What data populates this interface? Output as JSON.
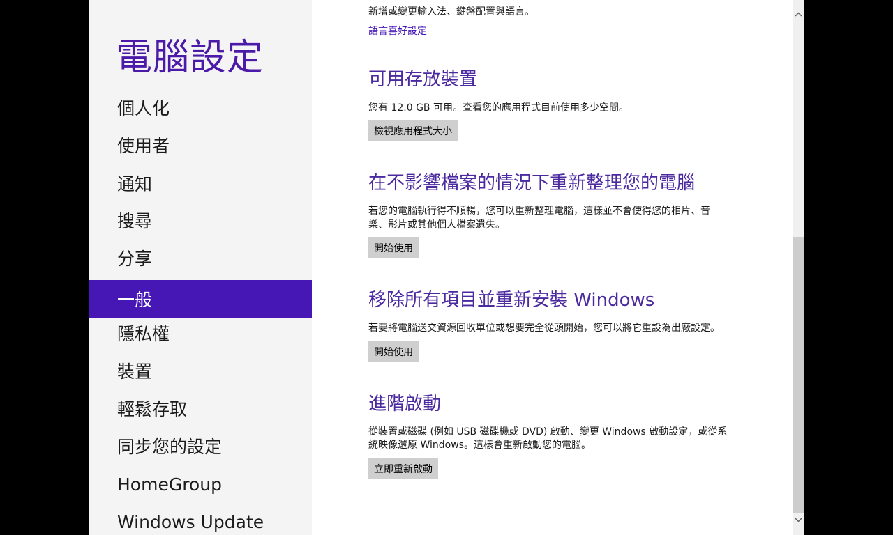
{
  "sidebar": {
    "title": "電腦設定",
    "items": [
      {
        "label": "個人化"
      },
      {
        "label": "使用者"
      },
      {
        "label": "通知"
      },
      {
        "label": "搜尋"
      },
      {
        "label": "分享"
      },
      {
        "label": "一般",
        "active": true
      },
      {
        "label": "隱私權"
      },
      {
        "label": "裝置"
      },
      {
        "label": "輕鬆存取"
      },
      {
        "label": "同步您的設定"
      },
      {
        "label": "HomeGroup"
      },
      {
        "label": "Windows Update"
      }
    ]
  },
  "language": {
    "description": "新增或變更輸入法、鍵盤配置與語言。",
    "link": "語言喜好設定"
  },
  "storage": {
    "heading": "可用存放裝置",
    "description": "您有 12.0 GB 可用。查看您的應用程式目前使用多少空間。",
    "button": "檢視應用程式大小"
  },
  "refresh": {
    "heading": "在不影響檔案的情況下重新整理您的電腦",
    "description_line1": "若您的電腦執行得不順暢，您可以重新整理電腦，這樣並不會使得您的相片、音",
    "description_line2": "樂、影片或其他個人檔案遺失。",
    "button": "開始使用"
  },
  "reset": {
    "heading": "移除所有項目並重新安裝 Windows",
    "description": "若要將電腦送交資源回收單位或想要完全從頭開始，您可以將它重設為出廠設定。",
    "button": "開始使用"
  },
  "advanced": {
    "heading": "進階啟動",
    "description_line1": "從裝置或磁碟 (例如 USB 磁碟機或 DVD) 啟動、變更 Windows 啟動設定，或從系",
    "description_line2": "統映像還原 Windows。這樣會重新啟動您的電腦。",
    "button": "立即重新啟動"
  },
  "icons": {
    "scroll_up": "chevron-up-icon",
    "scroll_down": "chevron-down-icon"
  },
  "colors": {
    "accent": "#4617b4",
    "heading": "#4b2aa0",
    "sidebar_bg": "#f4f4f4",
    "button_bg": "#cfcfcf"
  }
}
